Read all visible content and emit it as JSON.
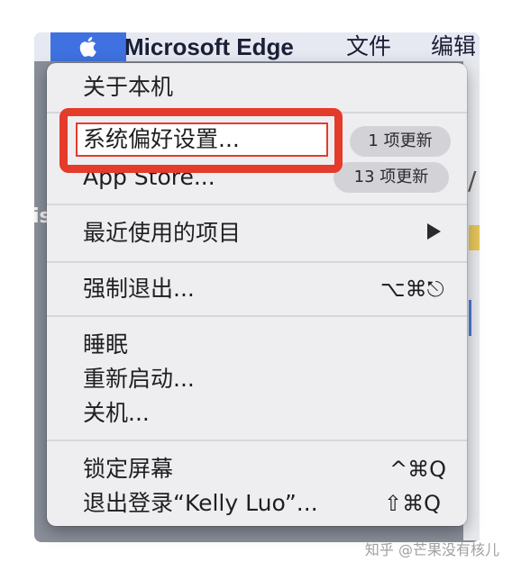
{
  "menubar": {
    "apple_icon": "apple-logo-icon",
    "app_name": "Microsoft Edge",
    "file": "文件",
    "edit": "编辑"
  },
  "menu": {
    "about": "关于本机",
    "system_prefs": "系统偏好设置...",
    "system_prefs_badge": "1 项更新",
    "app_store": "App Store...",
    "app_store_badge": "13 项更新",
    "recent_items": "最近使用的项目",
    "recent_items_submenu_icon": "submenu-arrow-icon",
    "force_quit": "强制退出...",
    "force_quit_shortcut": "⌥⌘⎋",
    "sleep": "睡眠",
    "restart": "重新启动...",
    "shutdown": "关机...",
    "lock_screen": "锁定屏幕",
    "lock_screen_shortcut": "^⌘Q",
    "logout": "退出登录“Kelly Luo”...",
    "logout_shortcut": "⇧⌘Q"
  },
  "background": {
    "left_text": "is",
    "right_text": "/"
  },
  "watermark": "知乎 @芒果没有核儿",
  "colors": {
    "highlight": "#e43b2a",
    "apple_menu_active": "#3f72e0",
    "menu_bg": "#eeeef0"
  }
}
